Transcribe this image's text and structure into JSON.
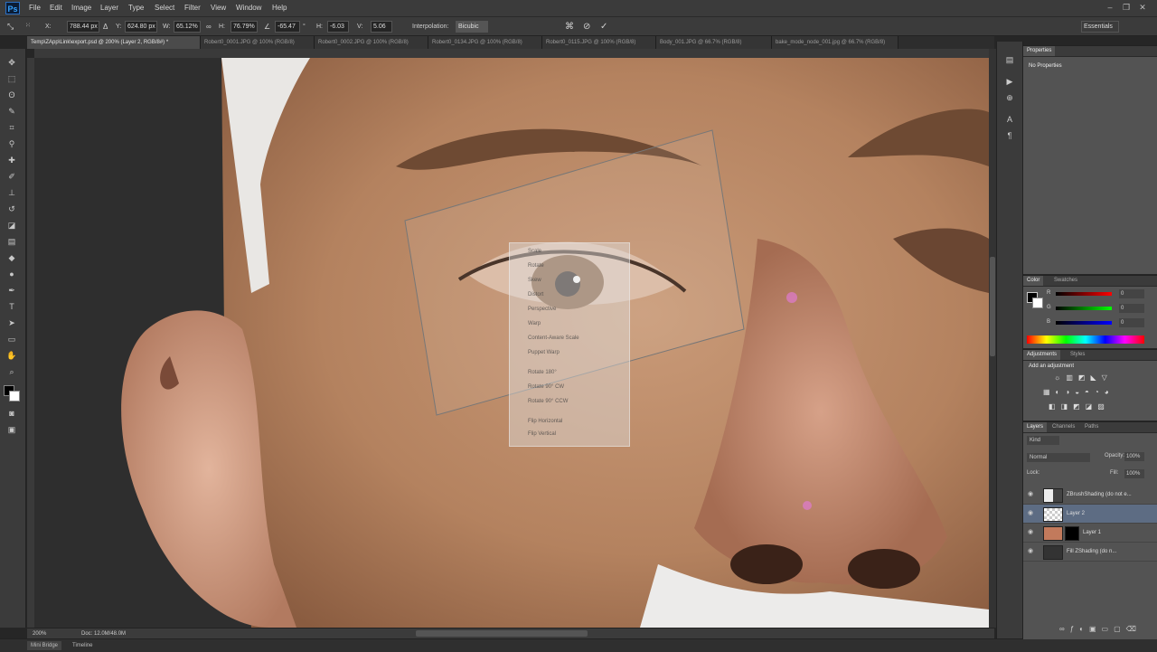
{
  "app": {
    "logo": "Ps"
  },
  "menu": [
    "File",
    "Edit",
    "Image",
    "Layer",
    "Type",
    "Select",
    "Filter",
    "View",
    "Window",
    "Help"
  ],
  "options": {
    "x_value": "788.44 px",
    "y_value": "624.80 px",
    "w_label": "W:",
    "w_value": "65.12%",
    "h_label": "H:",
    "h_value": "76.79%",
    "angle_value": "-65.47",
    "h_skew_label": "H:",
    "h_skew_value": "-6.03",
    "v_skew_label": "V:",
    "v_skew_value": "5.06",
    "interpolation_label": "Interpolation:",
    "interpolation_value": "Bicubic",
    "workspace": "Essentials"
  },
  "tabs": [
    {
      "label": "Temp\\ZApp\\Link\\export.psd @ 200% (Layer 2, RGB/8#) *",
      "active": true
    },
    {
      "label": "Robert0_0001.JPG @ 100% (RGB/8)",
      "active": false
    },
    {
      "label": "Robert0_0002.JPG @ 100% (RGB/8)",
      "active": false
    },
    {
      "label": "Robert0_0134.JPG @ 100% (RGB/8)",
      "active": false
    },
    {
      "label": "Robert0_0115.JPG @ 100% (RGB/8)",
      "active": false
    },
    {
      "label": "Body_001.JPG @ 66.7% (RGB/8)",
      "active": false
    },
    {
      "label": "bake_mode_node_001.jpg @ 66.7% (RGB/8)",
      "active": false
    }
  ],
  "status": {
    "zoom": "200%",
    "doc": "Doc: 12.0M/48.0M"
  },
  "bottom_tabs": [
    "Mini Bridge",
    "Timeline"
  ],
  "context_menu": [
    "Scale",
    "Rotate",
    "Skew",
    "Distort",
    "Perspective",
    "Warp",
    "Content-Aware Scale",
    "Puppet Warp",
    "Rotate 180°",
    "Rotate 90° CW",
    "Rotate 90° CCW",
    "Flip Horizontal",
    "Flip Vertical"
  ],
  "properties": {
    "tab": "Properties",
    "empty_text": "No Properties"
  },
  "color_panel": {
    "tabs": [
      "Color",
      "Swatches"
    ],
    "r_label": "R",
    "g_label": "G",
    "b_label": "B",
    "r_value": "0",
    "g_value": "0",
    "b_value": "0"
  },
  "adjustments": {
    "tabs": [
      "Adjustments",
      "Styles"
    ],
    "title": "Add an adjustment"
  },
  "layers_panel": {
    "tabs": [
      "Layers",
      "Channels",
      "Paths"
    ],
    "kind_label": "Kind",
    "blend_mode": "Normal",
    "opacity_label": "Opacity:",
    "opacity_value": "100%",
    "lock_label": "Lock:",
    "fill_label": "Fill:",
    "fill_value": "100%",
    "layers": [
      {
        "name": "ZBrushShading (do not e...",
        "selected": false
      },
      {
        "name": "Layer 2",
        "selected": true
      },
      {
        "name": "Layer 1",
        "selected": false
      },
      {
        "name": "Fill ZShading (do n...",
        "selected": false
      }
    ]
  },
  "colors": {
    "ui_dark": "#3b3b3b",
    "panel": "#535353",
    "selection": "#5d6c83",
    "ps_blue": "#36a3ff"
  }
}
